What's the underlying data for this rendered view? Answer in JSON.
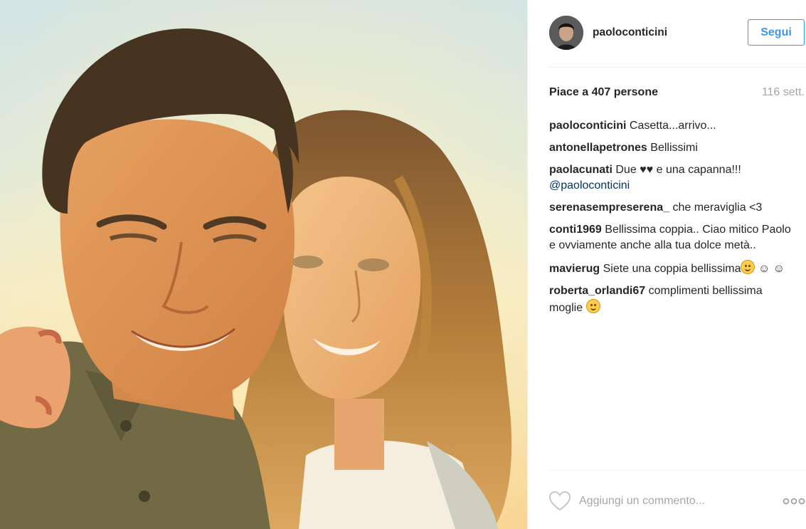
{
  "post": {
    "photo_alt": "Selfie of a man and a woman in warm sunlight",
    "author": {
      "username": "paoloconticini",
      "avatar_icon": "profile-avatar"
    },
    "follow_label": "Segui",
    "likes_label": "Piace a 407 persone",
    "time_label": "116 sett.",
    "comments": [
      {
        "user": "paoloconticini",
        "text": "Casetta...arrivo..."
      },
      {
        "user": "antonellapetrones",
        "text": "Bellissimi"
      },
      {
        "user": "paolacunati",
        "text": "Due ♥♥ e una capanna!!!",
        "mention": "@paoloconticini"
      },
      {
        "user": "serenasempreserena_",
        "text": "che meraviglia <3"
      },
      {
        "user": "conti1969",
        "text": "Bellissima coppia.. Ciao mitico Paolo e ovviamente anche alla tua dolce metà.."
      },
      {
        "user": "mavierug",
        "text": "Siete una coppia bellissima",
        "after_emoji": "☺ ☺"
      },
      {
        "user": "roberta_orlandi67",
        "text": "complimenti bellissima moglie"
      }
    ],
    "comment_placeholder": "Aggiungi un commento...",
    "icons": {
      "like": "heart-icon",
      "more": "more-options-icon",
      "emoji": "smiley-emoji"
    },
    "colors": {
      "accent": "#3897f0",
      "text": "#262626",
      "muted": "#a5a7aa",
      "mention": "#003569"
    }
  }
}
